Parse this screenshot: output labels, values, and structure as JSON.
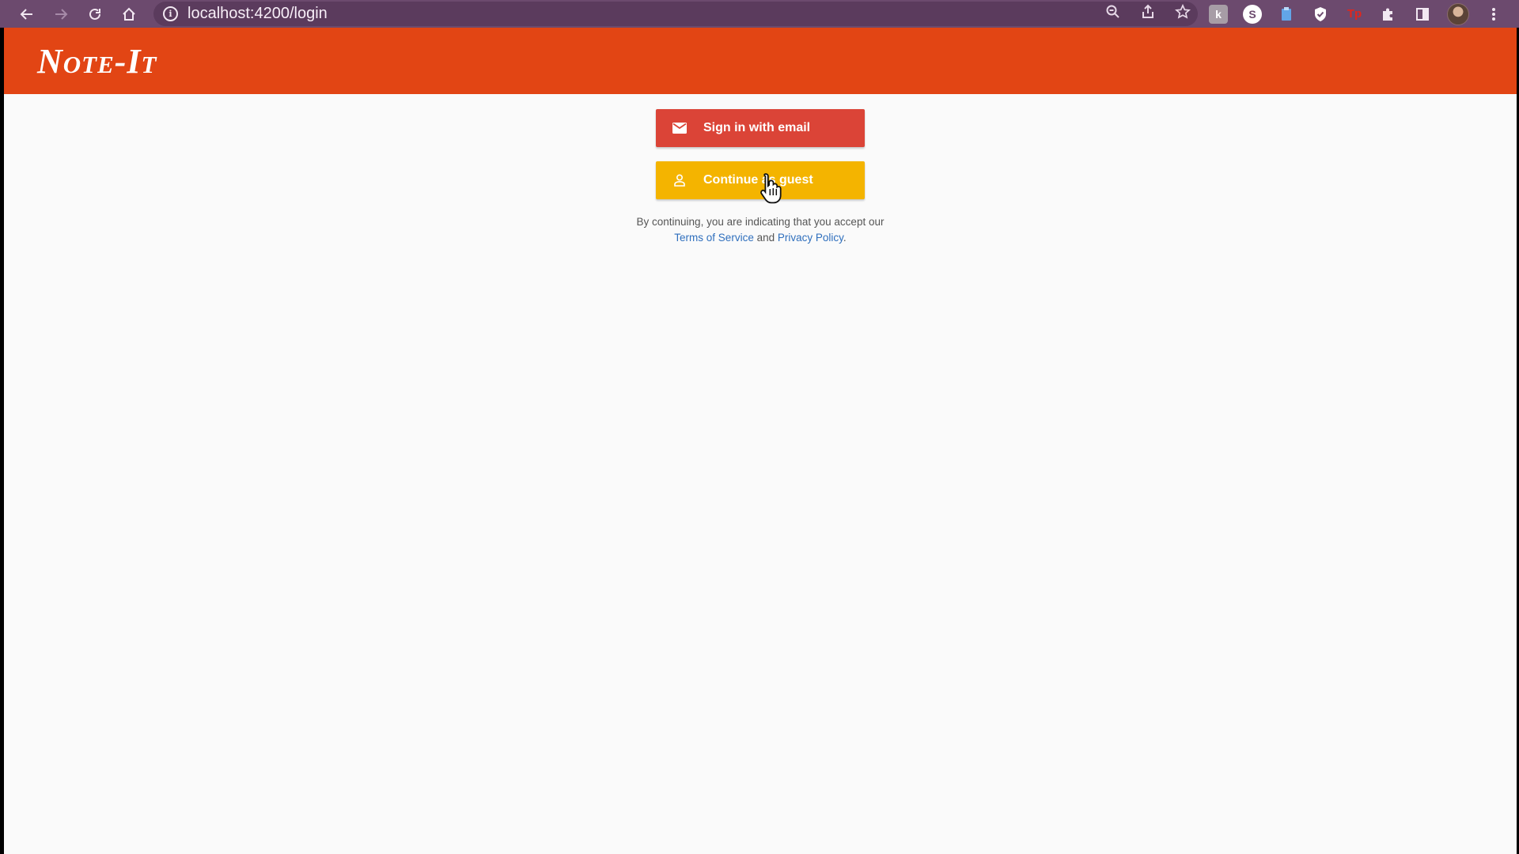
{
  "browser": {
    "url": "localhost:4200/login"
  },
  "app": {
    "title": "Note-It"
  },
  "auth": {
    "email_label": "Sign in with email",
    "guest_label": "Continue as guest",
    "email_color": "#db4437",
    "guest_color": "#f4b400"
  },
  "legal": {
    "prefix": "By continuing, you are indicating that you accept our",
    "terms": "Terms of Service",
    "and": "and",
    "privacy": "Privacy Policy",
    "suffix": "."
  },
  "colors": {
    "appbar": "#e24514",
    "chrome": "#6c4a6e",
    "link": "#2f6fbd"
  },
  "icons": {
    "back": "back-arrow-icon",
    "forward": "forward-arrow-icon",
    "reload": "reload-icon",
    "home": "home-icon",
    "site_info": "info-icon",
    "zoom": "zoom-icon",
    "share": "share-icon",
    "bookmark": "star-icon",
    "extensions": "puzzle-icon",
    "side_panel": "side-panel-icon",
    "menu": "kebab-menu-icon",
    "email": "mail-icon",
    "guest": "person-icon",
    "pointer": "hand-cursor-icon"
  }
}
